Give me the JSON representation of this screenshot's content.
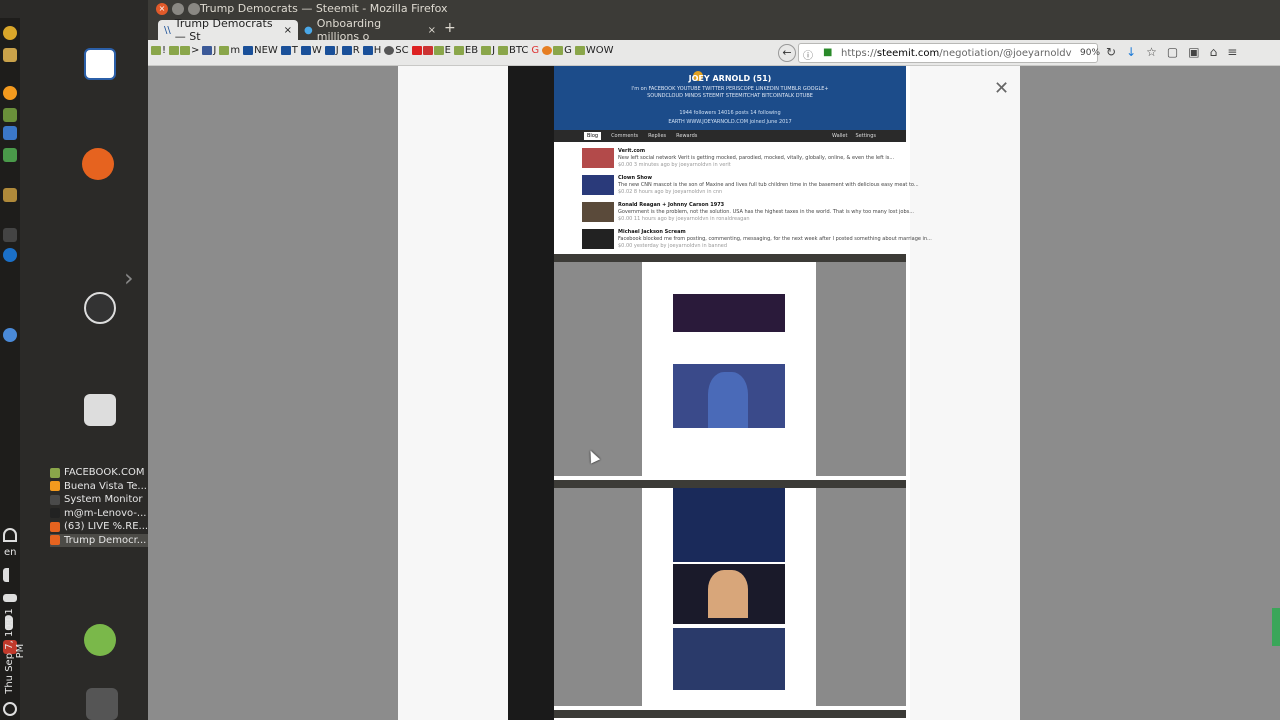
{
  "window": {
    "title": "Trump Democrats — Steemit - Mozilla Firefox"
  },
  "tabs": [
    {
      "label": "Trump Democrats — St"
    },
    {
      "label": "Onboarding millions o"
    }
  ],
  "bookmarks": [
    {
      "label": "!"
    },
    {
      "label": ">"
    },
    {
      "label": "J"
    },
    {
      "label": "m"
    },
    {
      "label": "NEW"
    },
    {
      "label": "T"
    },
    {
      "label": "W"
    },
    {
      "label": "J"
    },
    {
      "label": "R"
    },
    {
      "label": "H"
    },
    {
      "label": "SC"
    },
    {
      "label": "E"
    },
    {
      "label": "EB"
    },
    {
      "label": "J"
    },
    {
      "label": "BTC"
    },
    {
      "label": "G"
    },
    {
      "label": "G"
    },
    {
      "label": "WOW"
    }
  ],
  "urlbar": {
    "scheme": "https://",
    "host": "steemit.com",
    "path": "/negotiation/@joeyarnoldv"
  },
  "zoom": "90%",
  "tasklist": [
    {
      "label": "FACEBOOK.COM"
    },
    {
      "label": "Buena Vista Te..."
    },
    {
      "label": "System Monitor"
    },
    {
      "label": "m@m-Lenovo-..."
    },
    {
      "label": "(63) LIVE %.RE..."
    },
    {
      "label": "Trump Democr..."
    }
  ],
  "lang": "en",
  "clock": "Thu Sep 7, 10:01 PM",
  "profile": {
    "name": "JOEY ARNOLD",
    "rep": "(51)",
    "bio": "I'm on FACEBOOK YOUTUBE TWITTER PERISCOPE LINKEDIN TUMBLR GOOGLE+ SOUNDCLOUD MINDS STEEMIT STEEMITCHAT BITCOINTALK DTUBE",
    "stats": "1944 followers   14016 posts   14 following",
    "location": "EARTH   WWW.JOEYARNOLD.COM   joined June 2017",
    "tabs": [
      "Blog",
      "Comments",
      "Replies",
      "Rewards"
    ],
    "right_tabs": [
      "Wallet",
      "Settings"
    ]
  },
  "posts": [
    {
      "title": "Verit.com",
      "desc": "New left social network Verit is getting mocked, parodied, mocked, vitally, globally, online, & even the left is...",
      "meta": "$0.00   3 minutes ago by joeyarnoldvn in verit"
    },
    {
      "title": "Clown Show",
      "desc": "The new CNN mascot is the son of Maxine and lives full tub children time in the basement with delicious easy meat to...",
      "meta": "$0.02   8 hours ago by joeyarnoldvn in cnn"
    },
    {
      "title": "Ronald Reagan + Johnny Carson 1973",
      "desc": "Government is the problem, not the solution. USA has the highest taxes in the world. That is why too many lost jobs...",
      "meta": "$0.00   11 hours ago by joeyarnoldvn in ronaldreagan"
    },
    {
      "title": "Michael Jackson Scream",
      "desc": "Facebook blocked me from posting, commenting, messaging, for the next week after I posted something about marriage in...",
      "meta": "$0.00   yesterday by joeyarnoldvn in banned"
    }
  ]
}
